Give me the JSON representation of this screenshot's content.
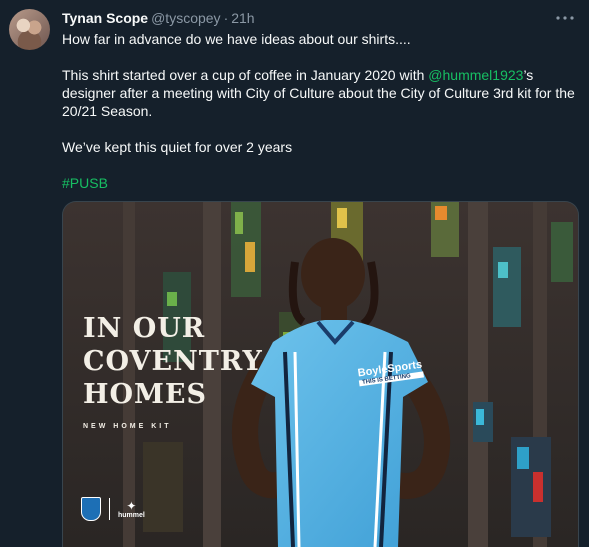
{
  "tweet": {
    "author_name": "Tynan Scope",
    "author_handle": "@tyscopey",
    "separator": "·",
    "time": "21h",
    "more_icon": "more-icon",
    "lines": {
      "line1": "How far in advance do we have ideas about our shirts....",
      "line2_pre": "This shirt started over a cup of coffee in January 2020 with ",
      "line2_mention": "@hummel1923",
      "line2_post": "’s designer after a meeting with City of Culture about the City of Culture 3rd kit for the 20/21 Season.",
      "line3": "We’ve kept this quiet for over 2 years",
      "hashtag": "#PUSB"
    }
  },
  "media": {
    "headline": [
      "IN OUR",
      "COVENTRY",
      "HOMES"
    ],
    "subline": "NEW HOME KIT",
    "sponsor": "BoyleSports",
    "sponsor_tag": "THIS IS BETTING",
    "brand_label": "hummel"
  }
}
